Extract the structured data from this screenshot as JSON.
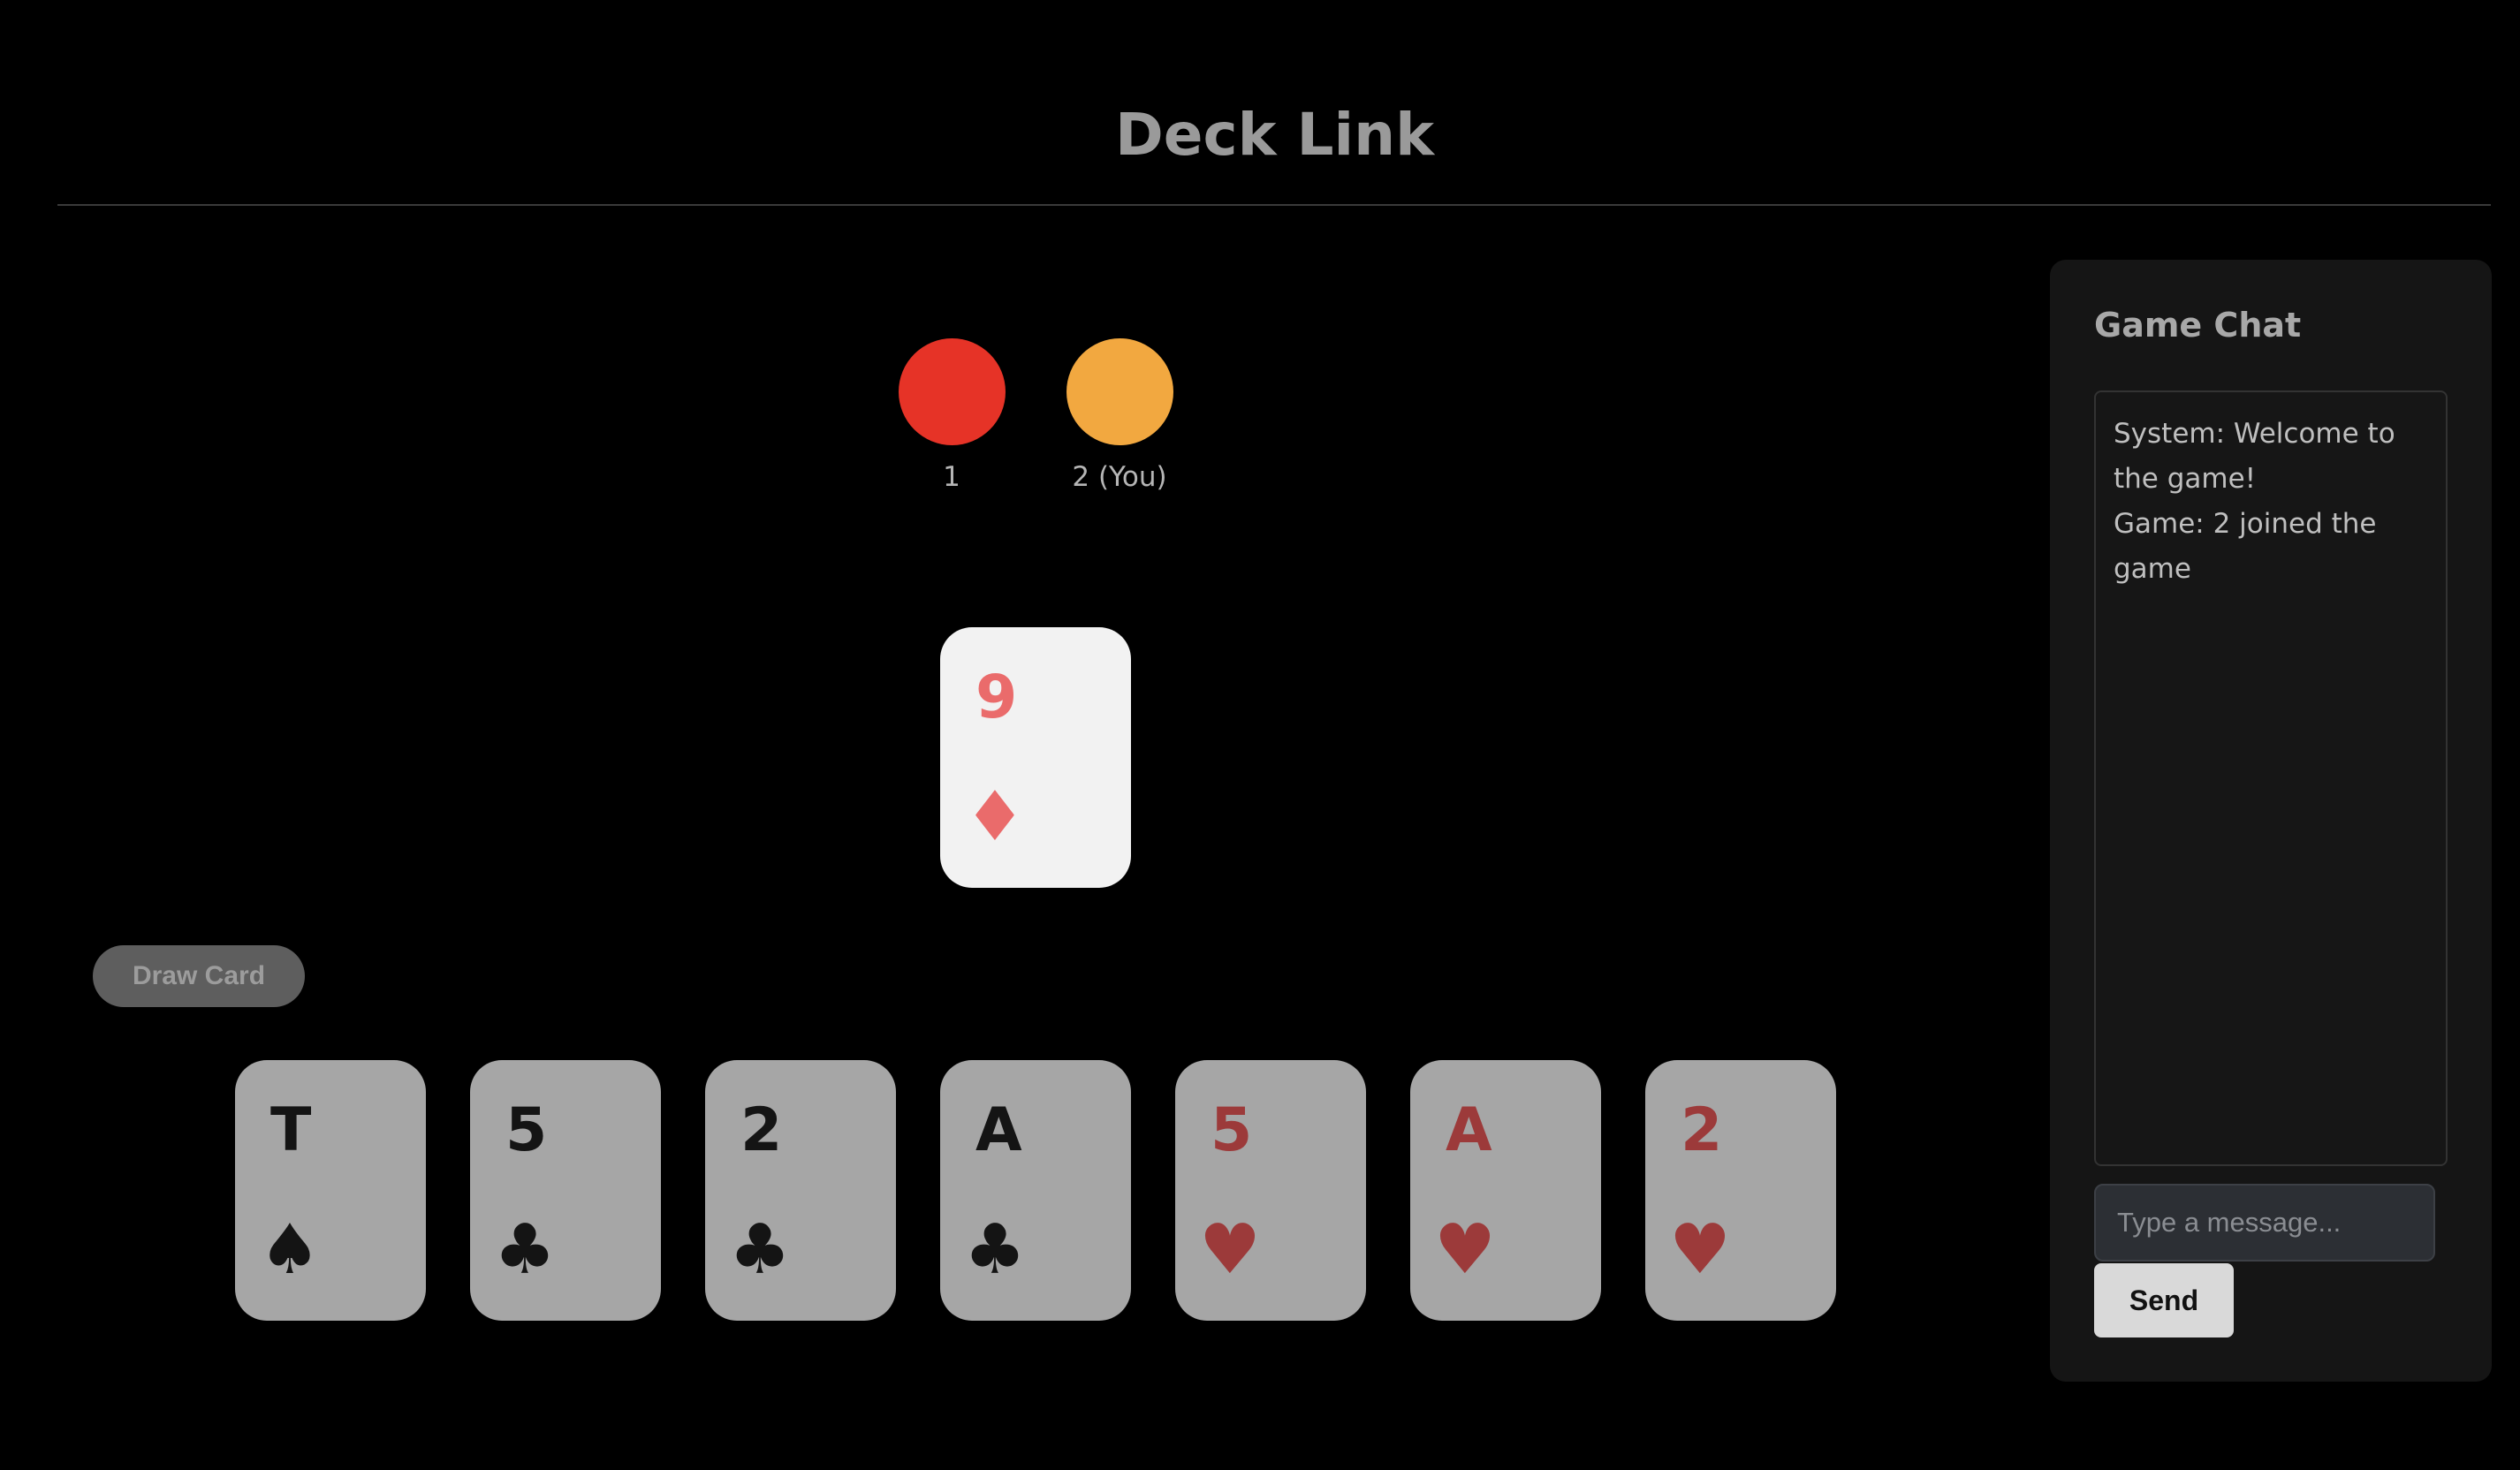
{
  "app": {
    "title": "Deck Link"
  },
  "players": [
    {
      "name": "1",
      "color": "#e63327"
    },
    {
      "name": "2 (You)",
      "color": "#f2a840"
    }
  ],
  "discard_pile": {
    "rank": "9",
    "suit": "♦",
    "suit_name": "diamonds",
    "color": "#ea6b6b"
  },
  "actions": {
    "draw_label": "Draw Card"
  },
  "hand": [
    {
      "rank": "T",
      "suit": "♠",
      "suit_name": "spades"
    },
    {
      "rank": "5",
      "suit": "♣",
      "suit_name": "clubs"
    },
    {
      "rank": "2",
      "suit": "♣",
      "suit_name": "clubs"
    },
    {
      "rank": "A",
      "suit": "♣",
      "suit_name": "clubs"
    },
    {
      "rank": "5",
      "suit": "♥",
      "suit_name": "hearts"
    },
    {
      "rank": "A",
      "suit": "♥",
      "suit_name": "hearts"
    },
    {
      "rank": "2",
      "suit": "♥",
      "suit_name": "hearts"
    }
  ],
  "chat": {
    "title": "Game Chat",
    "messages": [
      "System: Welcome to the game!",
      "Game: 2 joined the game"
    ],
    "input_placeholder": "Type a message...",
    "send_label": "Send"
  }
}
